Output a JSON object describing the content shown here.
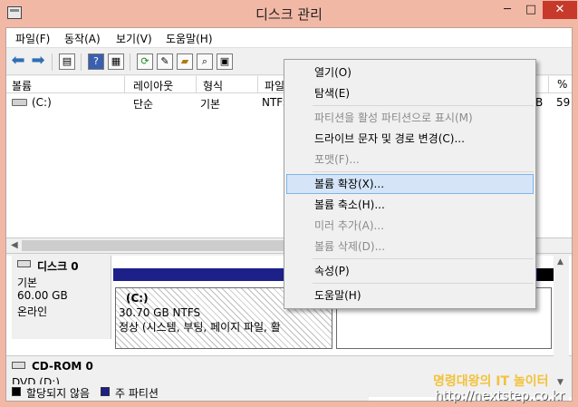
{
  "window": {
    "title": "디스크 관리"
  },
  "title_buttons": {
    "minimize": "─",
    "maximize": "□",
    "close": "✕"
  },
  "menu": [
    "파일(F)",
    "동작(A)",
    "보기(V)",
    "도움말(H)"
  ],
  "toolbar": {
    "back_icon": "back-arrow-icon",
    "forward_icon": "forward-arrow-icon"
  },
  "list": {
    "columns": [
      "볼륨",
      "레이아웃",
      "형식",
      "파일",
      "B",
      "%"
    ],
    "rows": [
      {
        "volume": "(C:)",
        "layout": "단순",
        "type": "기본",
        "fs": "NTFS",
        "extra1": "B",
        "extra2": "59"
      }
    ]
  },
  "disks": [
    {
      "title": "디스크 0",
      "kind": "기본",
      "size": "60.00 GB",
      "status": "온라인",
      "partition": {
        "name": "(C:)",
        "size": "30.70 GB NTFS",
        "status": "정상 (시스템, 부팅, 페이지 파일, 활"
      }
    },
    {
      "title": "CD-ROM 0",
      "kind": "DVD (D:)"
    }
  ],
  "legend": [
    {
      "label": "할당되지 않음",
      "color": "#000000"
    },
    {
      "label": "주 파티션",
      "color": "#1c2088"
    }
  ],
  "context_menu": [
    {
      "label": "열기(O)",
      "disabled": false
    },
    {
      "label": "탐색(E)",
      "disabled": false
    },
    {
      "sep": true
    },
    {
      "label": "파티션을 활성 파티션으로 표시(M)",
      "disabled": true
    },
    {
      "label": "드라이브 문자 및 경로 변경(C)...",
      "disabled": false
    },
    {
      "label": "포맷(F)...",
      "disabled": true
    },
    {
      "sep": true
    },
    {
      "label": "볼륨 확장(X)...",
      "disabled": false,
      "hover": true
    },
    {
      "label": "볼륨 축소(H)...",
      "disabled": false
    },
    {
      "label": "미러 추가(A)...",
      "disabled": true
    },
    {
      "label": "볼륨 삭제(D)...",
      "disabled": true
    },
    {
      "sep": true
    },
    {
      "label": "속성(P)",
      "disabled": false
    },
    {
      "sep": true
    },
    {
      "label": "도움말(H)",
      "disabled": false
    }
  ],
  "watermark": {
    "line1": "명령대왕의 IT 놀이터",
    "line2": "http://nextstep.co.kr"
  },
  "colors": {
    "title_bar": "#f2b8a6",
    "primary_partition": "#1c2088",
    "unallocated": "#000000",
    "menu_hover": "#d5e5f7"
  }
}
